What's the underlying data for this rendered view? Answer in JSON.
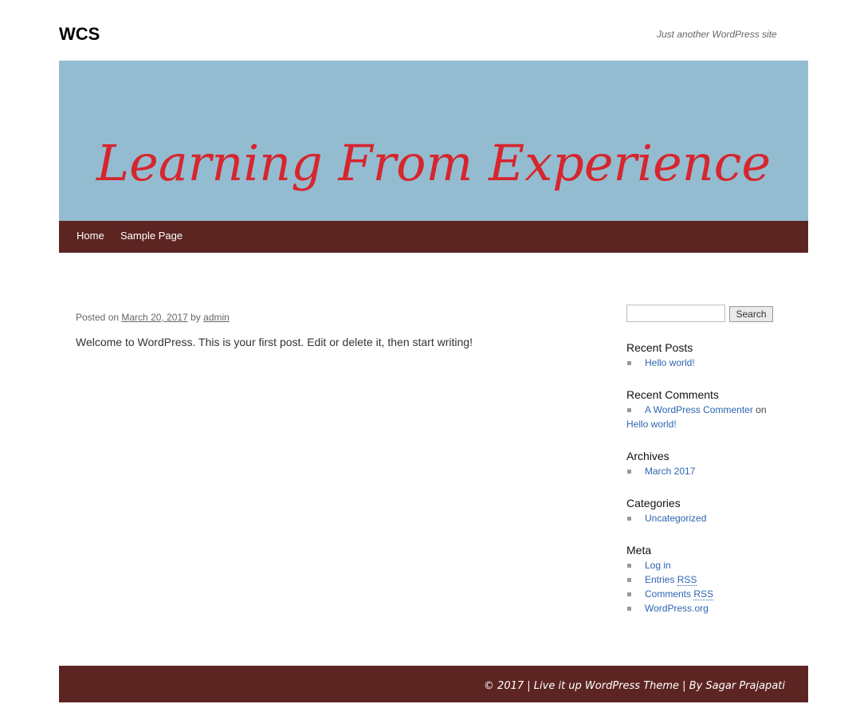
{
  "site": {
    "title": "WCS",
    "tagline": "Just another WordPress site",
    "header_text": "Learning From Experience"
  },
  "nav": {
    "items": [
      {
        "label": "Home"
      },
      {
        "label": "Sample Page"
      }
    ]
  },
  "post": {
    "posted_on_label": "Posted on",
    "date": "March 20, 2017",
    "by_label": "by",
    "author": "admin",
    "content": "Welcome to WordPress. This is your first post. Edit or delete it, then start writing!"
  },
  "sidebar": {
    "search": {
      "placeholder": "",
      "button_label": "Search"
    },
    "recent_posts": {
      "title": "Recent Posts",
      "items": [
        "Hello world!"
      ]
    },
    "recent_comments": {
      "title": "Recent Comments",
      "commenter": "A WordPress Commenter",
      "on_label": "on",
      "post": "Hello world!"
    },
    "archives": {
      "title": "Archives",
      "items": [
        "March 2017"
      ]
    },
    "categories": {
      "title": "Categories",
      "items": [
        "Uncategorized"
      ]
    },
    "meta": {
      "title": "Meta",
      "log_in": "Log in",
      "entries_label": "Entries",
      "comments_label": "Comments",
      "rss_abbr": "RSS",
      "wordpress_org": "WordPress.org"
    }
  },
  "footer": {
    "text": "© 2017 | Live it up WordPress Theme | By Sagar Prajapati"
  },
  "colors": {
    "header_bg": "#94bcd0",
    "header_text": "#d6262e",
    "nav_bg": "#5c2522",
    "link": "#2c65b1"
  }
}
